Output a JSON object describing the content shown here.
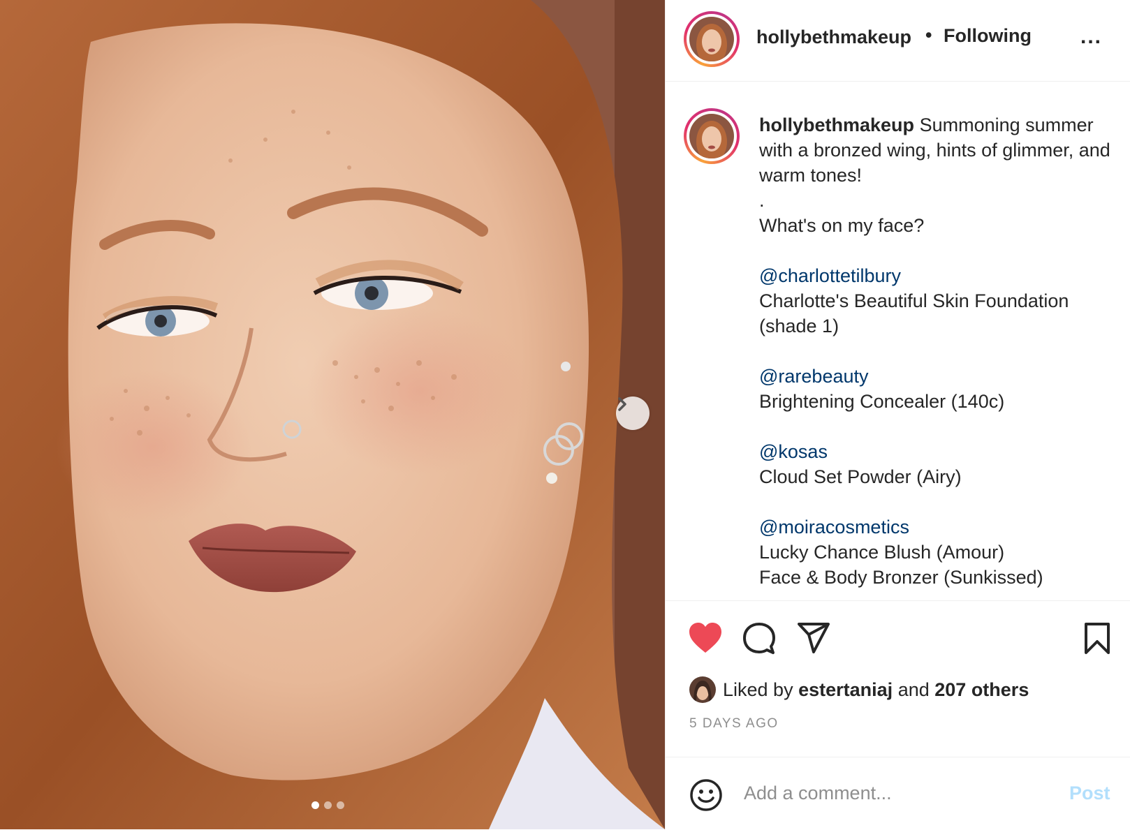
{
  "post": {
    "username": "hollybethmakeup",
    "separator": "•",
    "follow_status": "Following",
    "more_label": "...",
    "caption": {
      "username": "hollybethmakeup",
      "intro": "Summoning summer with a bronzed wing, hints of glimmer, and warm tones!",
      "dot_line": ".",
      "question": "What's on my face?",
      "products": [
        {
          "brand": "@charlottetilbury",
          "lines": [
            "Charlotte's Beautiful Skin Foundation (shade 1)"
          ]
        },
        {
          "brand": "@rarebeauty",
          "lines": [
            "Brightening Concealer (140c)"
          ]
        },
        {
          "brand": "@kosas",
          "lines": [
            "Cloud Set Powder (Airy)"
          ]
        },
        {
          "brand": "@moiracosmetics",
          "lines": [
            "Lucky Chance Blush (Amour)",
            "Face & Body Bronzer (Sunkissed)"
          ]
        }
      ]
    },
    "actions": {
      "like_icon": "heart-filled-icon",
      "comment_icon": "comment-icon",
      "share_icon": "paper-plane-icon",
      "save_icon": "bookmark-icon",
      "like_color": "#ed4956"
    },
    "likes": {
      "prefix": "Liked by",
      "user": "estertaniaj",
      "and": "and",
      "others": "207 others"
    },
    "timestamp": "5 DAYS AGO",
    "comment": {
      "placeholder": "Add a comment...",
      "post_label": "Post",
      "emoji_icon": "smiley-icon"
    },
    "carousel": {
      "slide_count": 3,
      "active_index": 0,
      "next_icon": "chevron-right-icon"
    }
  },
  "colors": {
    "link": "#00376b",
    "muted": "#8e8e8e",
    "post_disabled": "#b2dffc",
    "text": "#262626"
  }
}
